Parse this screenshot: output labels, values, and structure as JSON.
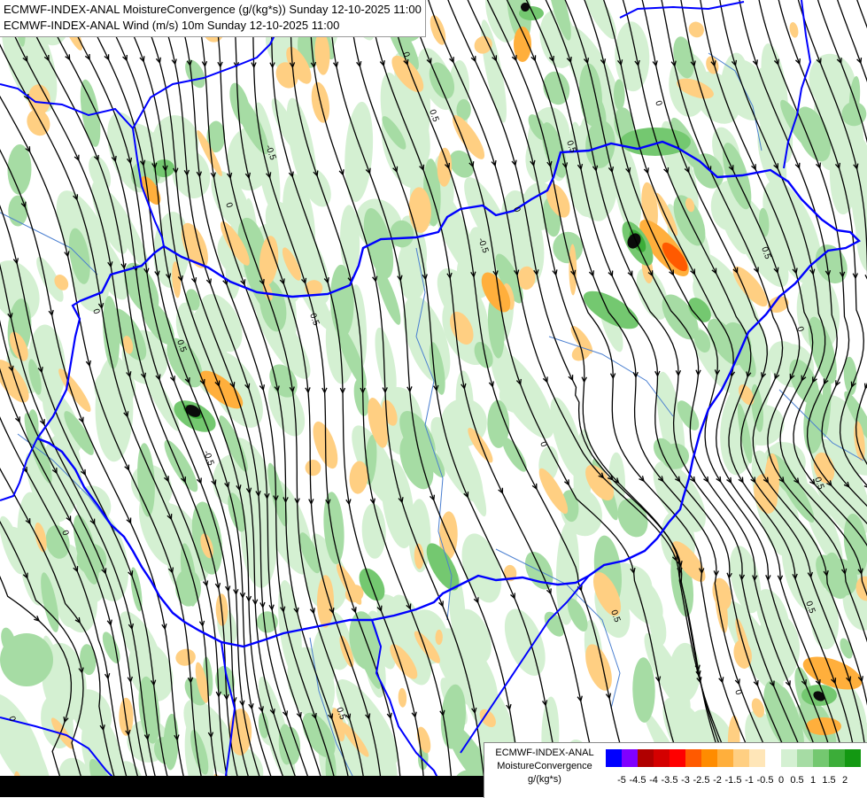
{
  "header": {
    "line1": "ECMWF-INDEX-ANAL MoistureConvergence (g/(kg*s)) Sunday 12-10-2025 11:00",
    "line2": "ECMWF-INDEX-ANAL Wind (m/s) 10m Sunday 12-10-2025 11:00"
  },
  "legend": {
    "title_line1": "ECMWF-INDEX-ANAL",
    "title_line2": "MoistureConvergence",
    "title_line3": "g/(kg*s)",
    "colors": [
      "#0000ff",
      "#8000ff",
      "#b00000",
      "#d40000",
      "#ff0000",
      "#ff5a00",
      "#ff8c00",
      "#ffaf3c",
      "#ffcf82",
      "#ffe6b8",
      "#ffffff",
      "#d4f0d2",
      "#a6dca4",
      "#74c870",
      "#3cad39",
      "#139812"
    ],
    "ticks": [
      "-5",
      "-4.5",
      "-4",
      "-3.5",
      "-3",
      "-2.5",
      "-2",
      "-1.5",
      "-1",
      "-0.5",
      "0",
      "0.5",
      "1",
      "1.5",
      "2"
    ]
  },
  "map": {
    "contour_labels": [
      "0",
      "0.5",
      "0",
      "-0.5",
      "0.5",
      "0",
      "0.5",
      "-0.5",
      "0",
      "0.5",
      "0",
      "0.5",
      "0",
      "0.5",
      "0",
      "-0.5",
      "0.5",
      "0",
      "0.5",
      "0",
      "0.5",
      "0"
    ],
    "colors": {
      "border": "#0000ff",
      "river": "#4a7fd0",
      "streamline": "#000000",
      "green_light": "#d4f0d2",
      "green_mid": "#a6dca4",
      "green_dark": "#74c870",
      "green_core": "#3cad39",
      "orange_light": "#ffcf82",
      "orange_mid": "#ffaf3c",
      "orange_dark": "#ff8c00",
      "red": "#ff5a00"
    }
  }
}
